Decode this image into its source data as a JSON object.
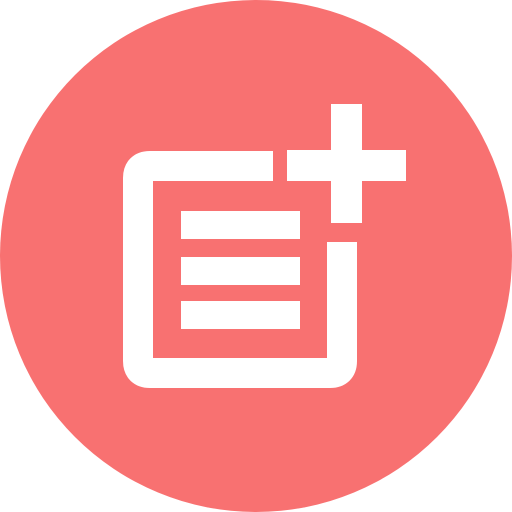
{
  "app_icon": {
    "name": "add-note-icon",
    "colors": {
      "background_circle": "#F87171",
      "glyph": "#FFFFFF"
    }
  }
}
